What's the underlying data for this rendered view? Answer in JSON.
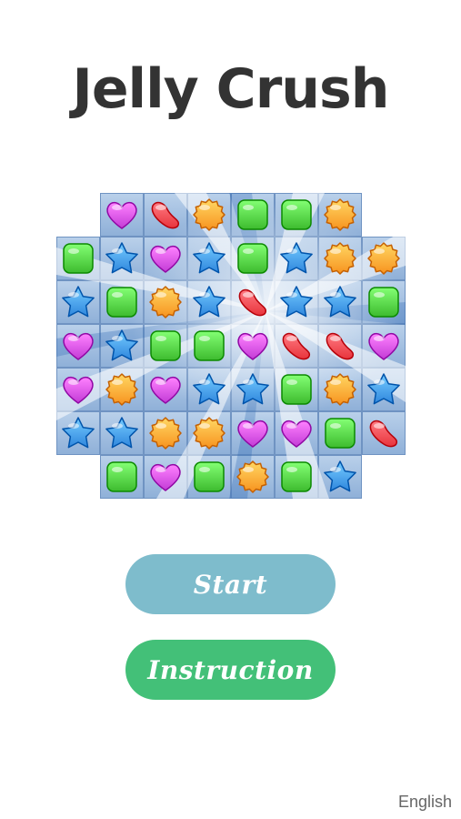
{
  "game": {
    "title": "Jelly Crush"
  },
  "menu": {
    "start_label": "Start",
    "instruction_label": "Instruction"
  },
  "footer": {
    "language_label": "English"
  },
  "board": {
    "rows": 7,
    "cols": 8,
    "grid": [
      [
        "empty",
        "heart",
        "bean",
        "flower",
        "square",
        "square",
        "flower",
        "empty"
      ],
      [
        "square",
        "star",
        "heart",
        "star",
        "square",
        "star",
        "flower",
        "flower"
      ],
      [
        "star",
        "square",
        "flower",
        "star",
        "bean",
        "star",
        "star",
        "square"
      ],
      [
        "heart",
        "star",
        "square",
        "square",
        "heart",
        "bean",
        "bean",
        "heart"
      ],
      [
        "heart",
        "flower",
        "heart",
        "star",
        "star",
        "square",
        "flower",
        "star"
      ],
      [
        "star",
        "star",
        "flower",
        "flower",
        "heart",
        "heart",
        "square",
        "bean"
      ],
      [
        "empty",
        "square",
        "heart",
        "square",
        "flower",
        "square",
        "star",
        "empty"
      ]
    ]
  },
  "colors": {
    "heart": "#c23bd6",
    "bean": "#e8343c",
    "flower": "#f7921e",
    "square": "#3dbb2e",
    "star": "#2f86dd",
    "start_button": "#7ebccc",
    "instruction_button": "#43c078",
    "title": "#333333"
  }
}
